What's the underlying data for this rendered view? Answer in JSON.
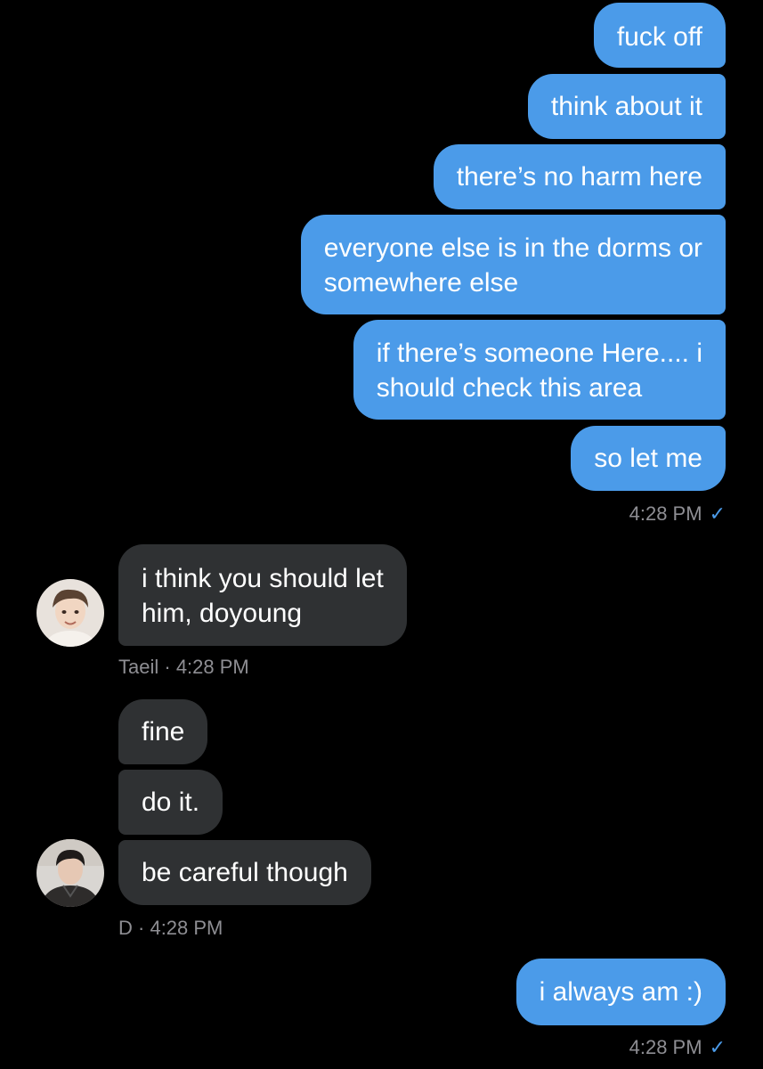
{
  "outgoing_top": [
    {
      "text": "fuck off"
    },
    {
      "text": "think about it"
    },
    {
      "text": "there’s no harm here"
    },
    {
      "line1": "everyone else is in the dorms or",
      "line2": "somewhere else"
    },
    {
      "line1": "if there’s someone Here.... i",
      "line2": "should check this area"
    },
    {
      "text": "so let me"
    }
  ],
  "receipt_1": {
    "time": "4:28 PM",
    "check": "✓"
  },
  "taeil": {
    "line1": "i think you should let",
    "line2": "him, doyoung",
    "sender": "Taeil",
    "sep": " · ",
    "time": "4:28 PM",
    "avatar": "taeil-avatar"
  },
  "doyoung": {
    "messages": [
      "fine",
      "do it.",
      "be careful though"
    ],
    "sender": "D",
    "sep": " · ",
    "time": "4:28 PM",
    "avatar": "doyoung-avatar"
  },
  "outgoing_bottom": {
    "text": "i always am :)"
  },
  "receipt_2": {
    "time": "4:28 PM",
    "check": "✓"
  },
  "colors": {
    "outgoing_bubble": "#4b9be9",
    "incoming_bubble": "#2f3133",
    "background": "#000000",
    "meta_text": "#8e8e93"
  }
}
